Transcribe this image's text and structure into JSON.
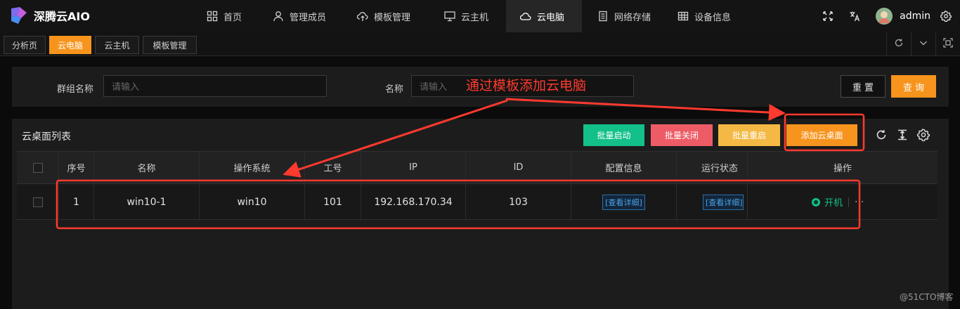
{
  "app": {
    "name": "深腾云AIO"
  },
  "nav": {
    "items": [
      {
        "label": "首页",
        "icon": "grid-icon"
      },
      {
        "label": "管理成员",
        "icon": "user-icon"
      },
      {
        "label": "模板管理",
        "icon": "cloud-upload-icon"
      },
      {
        "label": "云主机",
        "icon": "monitor-icon"
      },
      {
        "label": "云电脑",
        "icon": "cloud-icon"
      },
      {
        "label": "网络存储",
        "icon": "document-icon"
      },
      {
        "label": "设备信息",
        "icon": "table-icon"
      }
    ],
    "active": "云电脑"
  },
  "user": {
    "name": "admin"
  },
  "tabs": [
    {
      "label": "分析页"
    },
    {
      "label": "云电脑"
    },
    {
      "label": "云主机"
    },
    {
      "label": "模板管理"
    }
  ],
  "filter": {
    "group_label": "群组名称",
    "group_placeholder": "请输入",
    "name_label": "名称",
    "name_placeholder": "请输入",
    "reset_label": "重 置",
    "query_label": "查 询"
  },
  "list": {
    "title": "云桌面列表",
    "batch_start": "批量启动",
    "batch_stop": "批量关闭",
    "batch_restart": "批量重启",
    "add_label": "添加云桌面",
    "columns": [
      "序号",
      "名称",
      "操作系统",
      "工号",
      "IP",
      "ID",
      "配置信息",
      "运行状态",
      "操作"
    ],
    "rows": [
      {
        "index": "1",
        "name": "win10-1",
        "os": "win10",
        "work_no": "101",
        "ip": "192.168.170.34",
        "id": "103",
        "config": "[查看详细]",
        "status": "[查看详细]",
        "action": "开机",
        "more": "···"
      }
    ]
  },
  "annotation": {
    "text": "通过模板添加云电脑",
    "color": "#ff3a2f"
  },
  "watermark": "@51CTO博客",
  "colors": {
    "accent": "#f7941d",
    "green": "#13c089",
    "red": "#ed5c66",
    "yellow": "#f4b944",
    "link": "#4aa3e8"
  }
}
